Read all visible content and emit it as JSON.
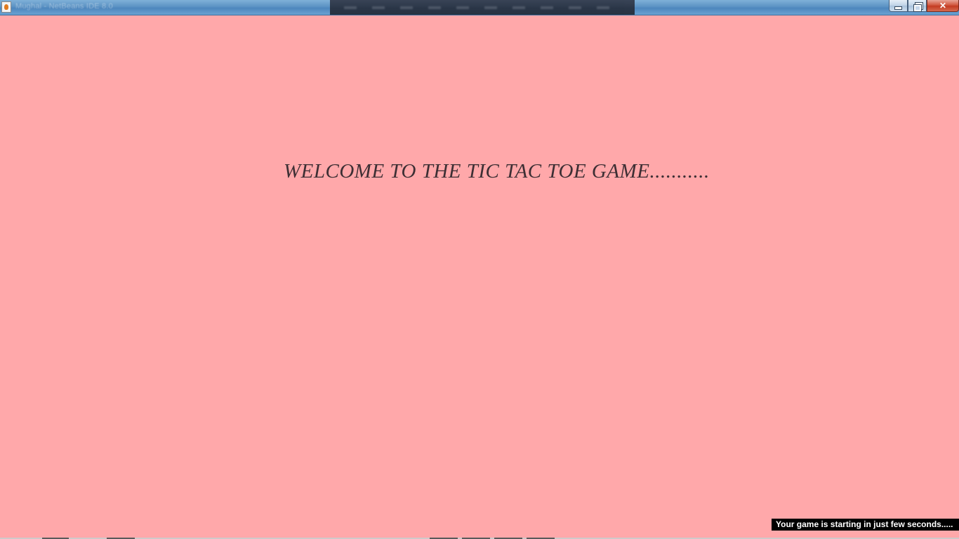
{
  "window": {
    "title": "Mughal - NetBeans IDE 8.0",
    "controls": {
      "minimize_icon": "minimize-icon",
      "restore_icon": "restore-icon",
      "close_label": "✕"
    }
  },
  "main": {
    "welcome_text": "WELCOME TO THE TIC TAC TOE GAME...........",
    "status_text": "Your game is starting in just few seconds.....",
    "background_color": "#ffa8aa"
  }
}
